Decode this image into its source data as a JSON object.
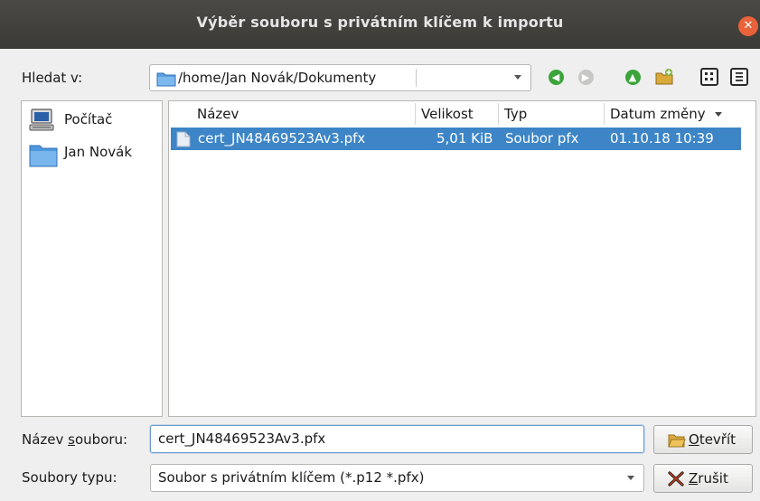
{
  "window": {
    "title": "Výběr souboru s privátním klíčem k importu"
  },
  "look_in": {
    "label": "Hledat v:",
    "path": "/home/Jan Novák/Dokumenty"
  },
  "toolbar": {
    "icons": [
      "back-icon",
      "forward-icon",
      "parent-directory-icon",
      "new-folder-icon",
      "list-view-icon",
      "detail-view-icon"
    ]
  },
  "places": [
    {
      "label": "Počítač",
      "icon": "computer-icon"
    },
    {
      "label": "Jan Novák",
      "icon": "folder-icon"
    }
  ],
  "files": {
    "columns": [
      "Název",
      "Velikost",
      "Typ",
      "Datum změny"
    ],
    "rows": [
      {
        "name": "cert_JN48469523Av3.pfx",
        "size": "5,01 KiB",
        "type": "Soubor pfx",
        "date": "01.10.18 10:39",
        "selected": true
      }
    ]
  },
  "filename": {
    "label_pre": "Název ",
    "label_access": "s",
    "label_post": "ouboru:",
    "value": "cert_JN48469523Av3.pfx"
  },
  "filetype": {
    "label": "Soubory typu:",
    "value": "Soubor s privátním klíčem (*.p12 *.pfx)"
  },
  "buttons": {
    "open": {
      "access": "O",
      "rest": "tevřít"
    },
    "cancel": {
      "access": "Z",
      "rest": "rušit"
    }
  },
  "colors": {
    "selection": "#3d85c6",
    "titlebar": "#3f3e3a",
    "close": "#e9623a",
    "nav_green": "#3aa53a"
  }
}
